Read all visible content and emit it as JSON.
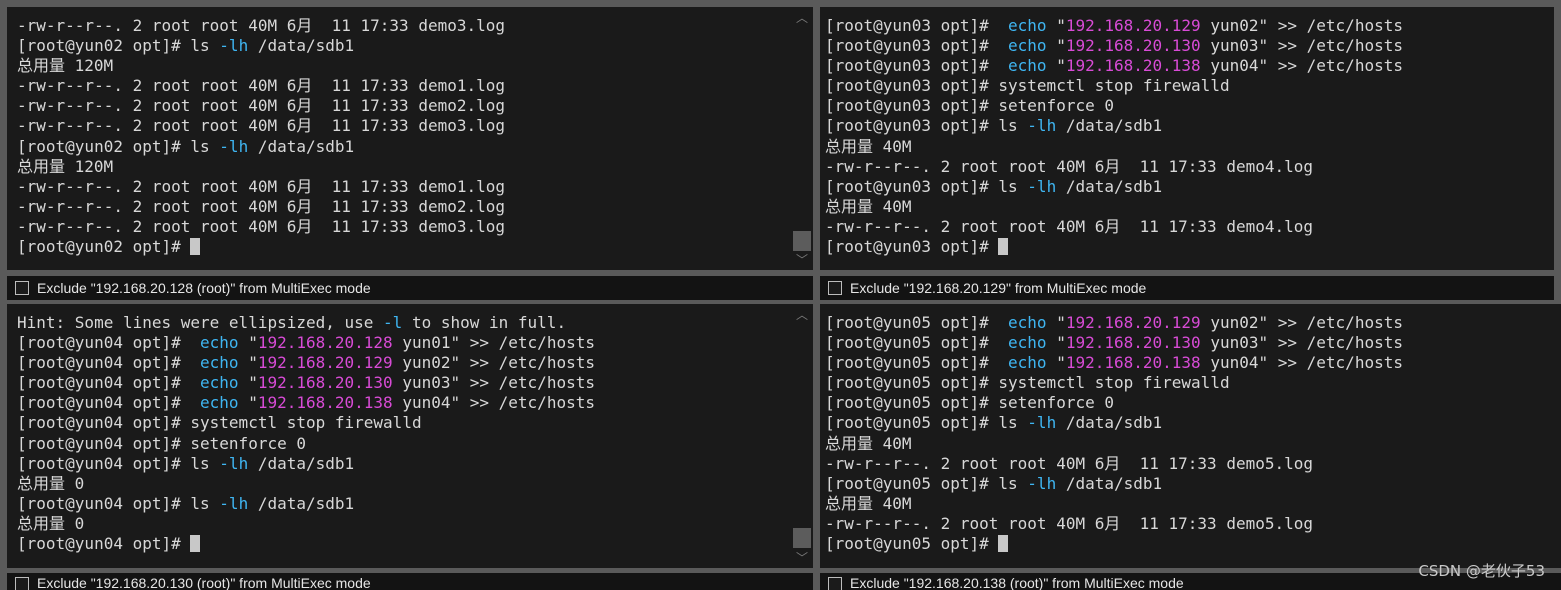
{
  "colors": {
    "command": "#3fb6f2",
    "string": "#d84bd6",
    "text": "#d8d8d8",
    "background": "#1a1a1a"
  },
  "panes": [
    {
      "exclude_label": "Exclude \"192.168.20.128 (root)\" from MultiExec mode",
      "lines": [
        [
          {
            "t": "-rw-r--r--. 2 root root 40M 6月  11 17:33 demo3.log"
          }
        ],
        [
          {
            "t": "[root@yun02 opt]# ls "
          },
          {
            "t": "-lh",
            "c": "flag"
          },
          {
            "t": " /data/sdb1"
          }
        ],
        [
          {
            "t": "总用量 120M"
          }
        ],
        [
          {
            "t": "-rw-r--r--. 2 root root 40M 6月  11 17:33 demo1.log"
          }
        ],
        [
          {
            "t": "-rw-r--r--. 2 root root 40M 6月  11 17:33 demo2.log"
          }
        ],
        [
          {
            "t": "-rw-r--r--. 2 root root 40M 6月  11 17:33 demo3.log"
          }
        ],
        [
          {
            "t": "[root@yun02 opt]# ls "
          },
          {
            "t": "-lh",
            "c": "flag"
          },
          {
            "t": " /data/sdb1"
          }
        ],
        [
          {
            "t": "总用量 120M"
          }
        ],
        [
          {
            "t": "-rw-r--r--. 2 root root 40M 6月  11 17:33 demo1.log"
          }
        ],
        [
          {
            "t": "-rw-r--r--. 2 root root 40M 6月  11 17:33 demo2.log"
          }
        ],
        [
          {
            "t": "-rw-r--r--. 2 root root 40M 6月  11 17:33 demo3.log"
          }
        ],
        [
          {
            "t": "[root@yun02 opt]# "
          },
          {
            "cursor": true
          }
        ]
      ]
    },
    {
      "exclude_label": "Exclude \"192.168.20.129\" from MultiExec mode",
      "lines": [
        [
          {
            "t": "[root@yun03 opt]#  "
          },
          {
            "t": "echo",
            "c": "cmd"
          },
          {
            "t": " \""
          },
          {
            "t": "192.168.20.129",
            "c": "str"
          },
          {
            "t": " yun02\" >> /etc/hosts"
          }
        ],
        [
          {
            "t": "[root@yun03 opt]#  "
          },
          {
            "t": "echo",
            "c": "cmd"
          },
          {
            "t": " \""
          },
          {
            "t": "192.168.20.130",
            "c": "str"
          },
          {
            "t": " yun03\" >> /etc/hosts"
          }
        ],
        [
          {
            "t": "[root@yun03 opt]#  "
          },
          {
            "t": "echo",
            "c": "cmd"
          },
          {
            "t": " \""
          },
          {
            "t": "192.168.20.138",
            "c": "str"
          },
          {
            "t": " yun04\" >> /etc/hosts"
          }
        ],
        [
          {
            "t": "[root@yun03 opt]# systemctl stop firewalld"
          }
        ],
        [
          {
            "t": "[root@yun03 opt]# setenforce 0"
          }
        ],
        [
          {
            "t": "[root@yun03 opt]# ls "
          },
          {
            "t": "-lh",
            "c": "flag"
          },
          {
            "t": " /data/sdb1"
          }
        ],
        [
          {
            "t": "总用量 40M"
          }
        ],
        [
          {
            "t": "-rw-r--r--. 2 root root 40M 6月  11 17:33 demo4.log"
          }
        ],
        [
          {
            "t": "[root@yun03 opt]# ls "
          },
          {
            "t": "-lh",
            "c": "flag"
          },
          {
            "t": " /data/sdb1"
          }
        ],
        [
          {
            "t": "总用量 40M"
          }
        ],
        [
          {
            "t": "-rw-r--r--. 2 root root 40M 6月  11 17:33 demo4.log"
          }
        ],
        [
          {
            "t": "[root@yun03 opt]# "
          },
          {
            "cursor": true
          }
        ]
      ]
    },
    {
      "exclude_label": "Exclude \"192.168.20.130 (root)\" from MultiExec mode",
      "lines": [
        [
          {
            "t": "Hint: Some lines were ellipsized, use "
          },
          {
            "t": "-l",
            "c": "flag"
          },
          {
            "t": " to show in full."
          }
        ],
        [
          {
            "t": "[root@yun04 opt]#  "
          },
          {
            "t": "echo",
            "c": "cmd"
          },
          {
            "t": " \""
          },
          {
            "t": "192.168.20.128",
            "c": "str"
          },
          {
            "t": " yun01\" >> /etc/hosts"
          }
        ],
        [
          {
            "t": "[root@yun04 opt]#  "
          },
          {
            "t": "echo",
            "c": "cmd"
          },
          {
            "t": " \""
          },
          {
            "t": "192.168.20.129",
            "c": "str"
          },
          {
            "t": " yun02\" >> /etc/hosts"
          }
        ],
        [
          {
            "t": "[root@yun04 opt]#  "
          },
          {
            "t": "echo",
            "c": "cmd"
          },
          {
            "t": " \""
          },
          {
            "t": "192.168.20.130",
            "c": "str"
          },
          {
            "t": " yun03\" >> /etc/hosts"
          }
        ],
        [
          {
            "t": "[root@yun04 opt]#  "
          },
          {
            "t": "echo",
            "c": "cmd"
          },
          {
            "t": " \""
          },
          {
            "t": "192.168.20.138",
            "c": "str"
          },
          {
            "t": " yun04\" >> /etc/hosts"
          }
        ],
        [
          {
            "t": "[root@yun04 opt]# systemctl stop firewalld"
          }
        ],
        [
          {
            "t": "[root@yun04 opt]# setenforce 0"
          }
        ],
        [
          {
            "t": "[root@yun04 opt]# ls "
          },
          {
            "t": "-lh",
            "c": "flag"
          },
          {
            "t": " /data/sdb1"
          }
        ],
        [
          {
            "t": "总用量 0"
          }
        ],
        [
          {
            "t": "[root@yun04 opt]# ls "
          },
          {
            "t": "-lh",
            "c": "flag"
          },
          {
            "t": " /data/sdb1"
          }
        ],
        [
          {
            "t": "总用量 0"
          }
        ],
        [
          {
            "t": "[root@yun04 opt]# "
          },
          {
            "cursor": true
          }
        ]
      ]
    },
    {
      "exclude_label": "Exclude \"192.168.20.138 (root)\" from MultiExec mode",
      "lines": [
        [
          {
            "t": "[root@yun05 opt]#  "
          },
          {
            "t": "echo",
            "c": "cmd"
          },
          {
            "t": " \""
          },
          {
            "t": "192.168.20.129",
            "c": "str"
          },
          {
            "t": " yun02\" >> /etc/hosts"
          }
        ],
        [
          {
            "t": "[root@yun05 opt]#  "
          },
          {
            "t": "echo",
            "c": "cmd"
          },
          {
            "t": " \""
          },
          {
            "t": "192.168.20.130",
            "c": "str"
          },
          {
            "t": " yun03\" >> /etc/hosts"
          }
        ],
        [
          {
            "t": "[root@yun05 opt]#  "
          },
          {
            "t": "echo",
            "c": "cmd"
          },
          {
            "t": " \""
          },
          {
            "t": "192.168.20.138",
            "c": "str"
          },
          {
            "t": " yun04\" >> /etc/hosts"
          }
        ],
        [
          {
            "t": "[root@yun05 opt]# systemctl stop firewalld"
          }
        ],
        [
          {
            "t": "[root@yun05 opt]# setenforce 0"
          }
        ],
        [
          {
            "t": "[root@yun05 opt]# ls "
          },
          {
            "t": "-lh",
            "c": "flag"
          },
          {
            "t": " /data/sdb1"
          }
        ],
        [
          {
            "t": "总用量 40M"
          }
        ],
        [
          {
            "t": "-rw-r--r--. 2 root root 40M 6月  11 17:33 demo5.log"
          }
        ],
        [
          {
            "t": "[root@yun05 opt]# ls "
          },
          {
            "t": "-lh",
            "c": "flag"
          },
          {
            "t": " /data/sdb1"
          }
        ],
        [
          {
            "t": "总用量 40M"
          }
        ],
        [
          {
            "t": "-rw-r--r--. 2 root root 40M 6月  11 17:33 demo5.log"
          }
        ],
        [
          {
            "t": "[root@yun05 opt]# "
          },
          {
            "cursor": true
          }
        ]
      ]
    }
  ],
  "scrollbar": {
    "up_icon": "chevron-up-icon",
    "down_icon": "chevron-down-icon"
  },
  "watermark": "CSDN @老伙子53"
}
